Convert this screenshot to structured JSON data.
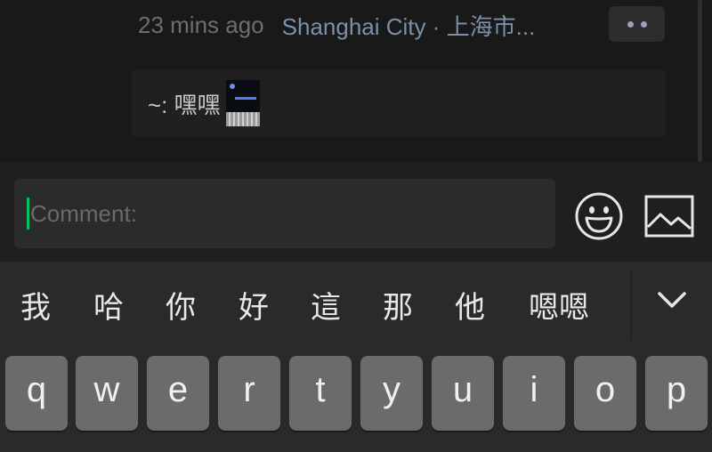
{
  "moment": {
    "time_ago": "23 mins ago",
    "location": "Shanghai City · 上海市..."
  },
  "comment": {
    "author_text": "~: 嘿嘿",
    "sticker_icon": "sticker-image"
  },
  "input": {
    "placeholder": "Comment:"
  },
  "candidates": [
    "我",
    "哈",
    "你",
    "好",
    "這",
    "那",
    "他",
    "嗯嗯"
  ],
  "keys": [
    "q",
    "w",
    "e",
    "r",
    "t",
    "y",
    "u",
    "i",
    "o",
    "p"
  ],
  "colors": {
    "background": "#191919",
    "link": "#7d90a9",
    "caret": "#07c160",
    "key": "#6b6b6b"
  }
}
